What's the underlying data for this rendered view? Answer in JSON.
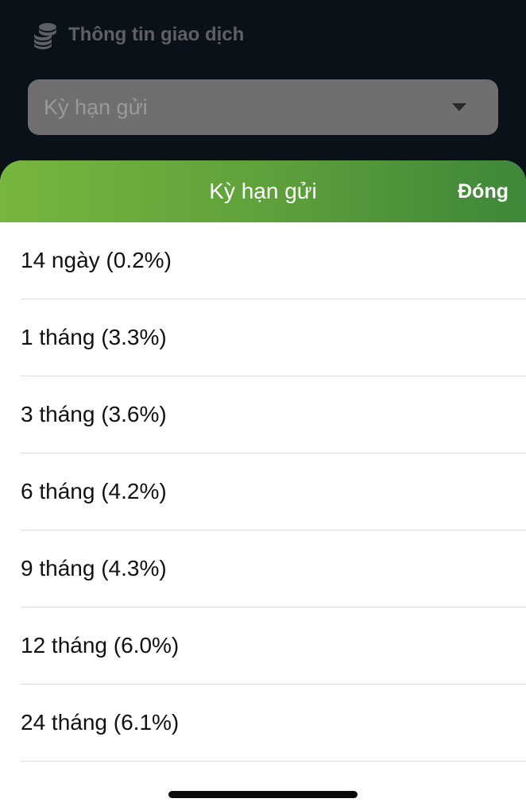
{
  "section": {
    "title": "Thông tin giao dịch",
    "icon": "coins-icon"
  },
  "dropdown": {
    "placeholder": "Kỳ hạn gửi",
    "icon": "chevron-down-icon"
  },
  "sheet": {
    "title": "Kỳ hạn gửi",
    "close_label": "Đóng",
    "options": [
      {
        "label": "14 ngày (0.2%)"
      },
      {
        "label": "1 tháng (3.3%)"
      },
      {
        "label": "3 tháng (3.6%)"
      },
      {
        "label": "6 tháng (4.2%)"
      },
      {
        "label": "9 tháng (4.3%)"
      },
      {
        "label": "12 tháng (6.0%)"
      },
      {
        "label": "24 tháng (6.1%)"
      }
    ]
  },
  "colors": {
    "background": "#0b1118",
    "header_gradient_start": "#76b63f",
    "header_gradient_end": "#3f873a",
    "dropdown_bg": "#6f6f6f"
  }
}
